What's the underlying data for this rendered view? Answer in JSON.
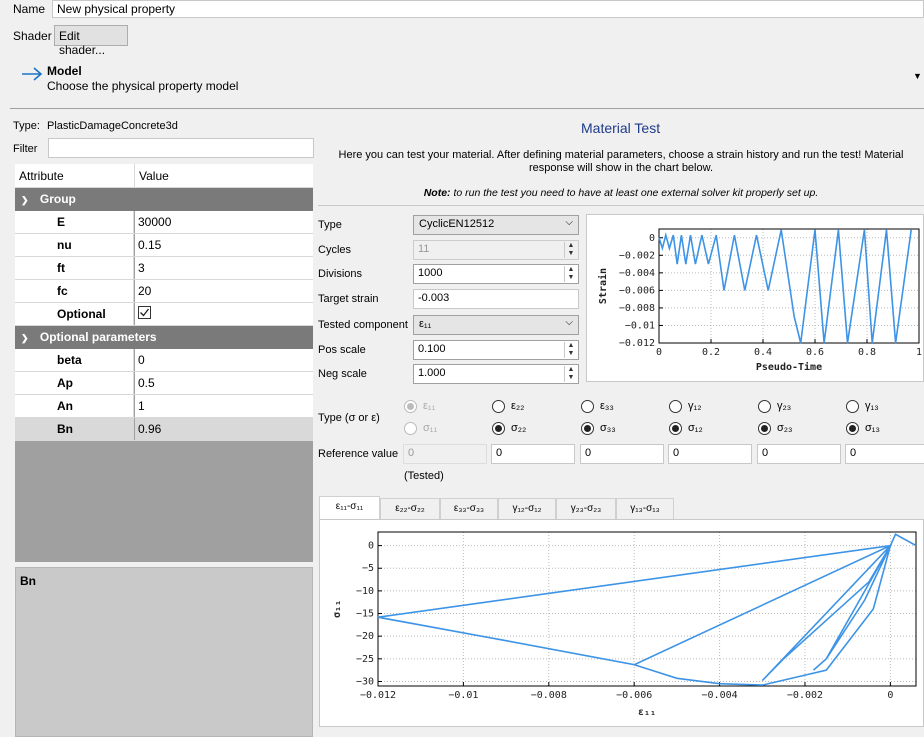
{
  "header": {
    "name_label": "Name",
    "name_value": "New physical property",
    "shader_label": "Shader",
    "shader_button": "Edit shader...",
    "model_title": "Model",
    "model_subtitle": "Choose the physical property model"
  },
  "left": {
    "type_label": "Type:",
    "type_value": "PlasticDamageConcrete3d",
    "filter_label": "Filter",
    "filter_value": "",
    "col_attribute": "Attribute",
    "col_value": "Value",
    "group_label": "Group",
    "rows": [
      {
        "name": "E",
        "value": "30000"
      },
      {
        "name": "nu",
        "value": "0.15"
      },
      {
        "name": "ft",
        "value": "3"
      },
      {
        "name": "fc",
        "value": "20"
      }
    ],
    "optional_label": "Optional",
    "optional_checked": true,
    "optional_group_label": "Optional parameters",
    "opt_rows": [
      {
        "name": "beta",
        "value": "0"
      },
      {
        "name": "Ap",
        "value": "0.5"
      },
      {
        "name": "An",
        "value": "1"
      },
      {
        "name": "Bn",
        "value": "0.96"
      }
    ],
    "description_title": "Bn"
  },
  "test": {
    "title": "Material Test",
    "intro": "Here you can test your material. After defining material parameters, choose a strain history and run the test! Material response will show in the chart below.",
    "note_bold": "Note:",
    "note_text": " to run the test you need to have at least one external solver kit properly set up.",
    "type_label": "Type",
    "type_value": "CyclicEN12512",
    "cycles_label": "Cycles",
    "cycles_value": "11",
    "divisions_label": "Divisions",
    "divisions_value": "1000",
    "target_label": "Target strain",
    "target_value": "-0.003",
    "component_label": "Tested component",
    "component_value": "ε₁₁",
    "pos_label": "Pos scale",
    "pos_value": "0.100",
    "neg_label": "Neg scale",
    "neg_value": "1.000",
    "type_se_label": "Type (σ or ε)",
    "eps_labels": [
      "ε₁₁",
      "ε₂₂",
      "ε₃₃",
      "γ₁₂",
      "γ₂₃",
      "γ₁₃"
    ],
    "sig_labels": [
      "σ₁₁",
      "σ₂₂",
      "σ₃₃",
      "σ₁₂",
      "σ₂₃",
      "σ₁₃"
    ],
    "ref_label": "Reference value",
    "ref_values": [
      "0",
      "0",
      "0",
      "0",
      "0",
      "0"
    ],
    "tested_label": "(Tested)",
    "tabs": [
      "ε₁₁-σ₁₁",
      "ε₂₂-σ₂₂",
      "ε₃₃-σ₃₃",
      "γ₁₂-σ₁₂",
      "γ₂₃-σ₂₃",
      "γ₁₃-σ₁₃"
    ]
  },
  "chart_data": [
    {
      "type": "line",
      "xlabel": "Pseudo-Time",
      "ylabel": "Strain",
      "xlim": [
        0,
        1
      ],
      "ylim": [
        -0.012,
        0.001
      ],
      "xticks": [
        "0",
        "0.2",
        "0.4",
        "0.6",
        "0.8",
        "1"
      ],
      "yticks": [
        "0",
        "−0.002",
        "−0.004",
        "−0.006",
        "−0.008",
        "−0.01",
        "−0.012"
      ],
      "grid": true,
      "color": "#3d94e6",
      "x": [
        0,
        0.013,
        0.026,
        0.04,
        0.055,
        0.07,
        0.086,
        0.103,
        0.121,
        0.14,
        0.165,
        0.19,
        0.22,
        0.25,
        0.29,
        0.33,
        0.375,
        0.42,
        0.47,
        0.52,
        0.545,
        0.6,
        0.635,
        0.69,
        0.725,
        0.79,
        0.82,
        0.875,
        0.91,
        0.97
      ],
      "y": [
        0,
        -0.0012,
        0.0003,
        -0.0012,
        0.0003,
        -0.003,
        0.0003,
        -0.003,
        0.0003,
        -0.003,
        0.0003,
        -0.003,
        0.0003,
        -0.006,
        0.0003,
        -0.006,
        0.0003,
        -0.006,
        0.0009,
        -0.009,
        -0.012,
        0.0009,
        -0.012,
        0.0009,
        -0.012,
        0.0009,
        -0.012,
        0.0009,
        -0.012,
        0.0009
      ]
    },
    {
      "type": "line",
      "xlabel": "ε₁₁",
      "ylabel": "σ₁₁",
      "xlim": [
        -0.012,
        0.0006
      ],
      "ylim": [
        -31,
        3
      ],
      "xticks": [
        "−0.012",
        "−0.01",
        "−0.008",
        "−0.006",
        "−0.004",
        "−0.002",
        "0"
      ],
      "yticks": [
        "0",
        "−5",
        "−10",
        "−15",
        "−20",
        "−25",
        "−30"
      ],
      "grid": true,
      "color": "#3d94e6",
      "x": [
        0.0006,
        0.00012,
        0.0,
        -0.0003,
        -0.0006,
        -0.0009,
        -0.0012,
        -0.0015,
        -0.0018,
        -0.0015,
        -0.0006,
        0.0,
        -0.003,
        -0.0025,
        -0.0005,
        0.0,
        -0.006,
        -0.005,
        -0.004,
        -0.003,
        -0.0015,
        -0.0004,
        0.0,
        -0.012,
        -0.009,
        -0.006,
        0.0
      ],
      "y": [
        0.0,
        2.5,
        0.0,
        -5,
        -10,
        -15,
        -20,
        -25,
        -27.5,
        -25,
        -12,
        0.0,
        -29.8,
        -25,
        -8,
        0.0,
        -26.3,
        -29.3,
        -30.5,
        -30.8,
        -27.5,
        -14,
        0.0,
        -15.8,
        -21,
        -26.3,
        0.0
      ]
    }
  ]
}
